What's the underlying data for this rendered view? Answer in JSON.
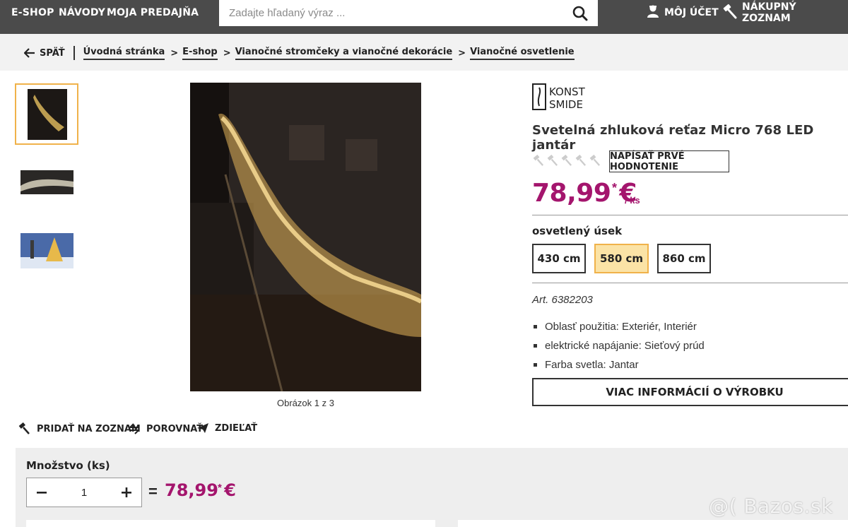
{
  "topnav": {
    "eshop": "E-SHOP",
    "guides": "NÁVODY",
    "my_store": "MOJA PREDAJŇA",
    "search_placeholder": "Zadajte hľadaný výraz ...",
    "account": "MÔJ ÚČET",
    "shopping_list": "NÁKUPNÝ ZOZNAM"
  },
  "breadcrumb": {
    "back": "SPÄŤ",
    "items": [
      "Úvodná stránka",
      "E-shop",
      "Vianočné stromčeky a vianočné dekorácie",
      "Vianočné osvetlenie"
    ]
  },
  "gallery": {
    "caption": "Obrázok 1 z 3",
    "selected_index": 0
  },
  "actions": {
    "add_to_list": "PRIDAŤ NA ZOZNAM",
    "compare": "POROVNAŤ",
    "share": "ZDIEĽAŤ"
  },
  "product": {
    "brand": "KONST SMIDE",
    "brand_line1": "KONST",
    "brand_line2": "SMIDE",
    "title": "Svetelná zhluková reťaz Micro 768 LED jantár",
    "rating": 0,
    "rate_button": "NAPÍSAŤ PRVÉ HODNOTENIE",
    "price": "78,99 €",
    "price_star": "*",
    "per_unit": "/ ks",
    "variant_label": "osvetlený úsek",
    "variants": [
      "430 cm",
      "580 cm",
      "860 cm"
    ],
    "selected_variant": "580 cm",
    "article": "Art. 6382203",
    "attributes": [
      "Oblasť použitia: Exteriér, Interiér",
      "elektrické napájanie: Sieťový prúd",
      "Farba svetla: Jantar"
    ],
    "more_info": "VIAC INFORMÁCIÍ O VÝROBKU"
  },
  "quantity": {
    "label": "Množstvo (ks)",
    "value": "1",
    "equals": "=",
    "total": "78,99 €",
    "total_star": "*"
  },
  "watermark": "@( Bazos.sk",
  "colors": {
    "topbar": "#4b4b4b",
    "price": "#a4156d",
    "selected_border": "#f0b24a",
    "selected_bg": "#fbe3a6"
  }
}
